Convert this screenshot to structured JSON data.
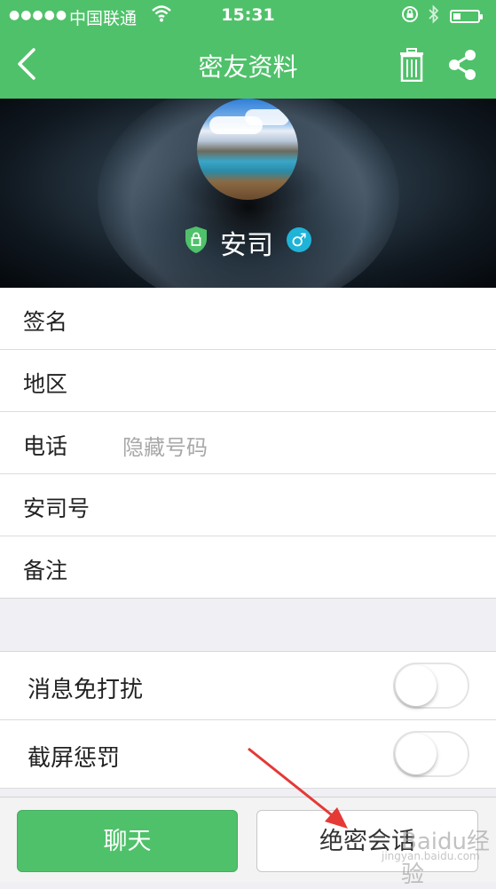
{
  "status_bar": {
    "signal": "●●●●●",
    "carrier": "中国联通",
    "time": "15:31"
  },
  "nav": {
    "title": "密友资料"
  },
  "profile": {
    "nickname": "安司",
    "gender_symbol": "♂"
  },
  "info_rows": [
    {
      "label": "签名",
      "value": ""
    },
    {
      "label": "地区",
      "value": ""
    },
    {
      "label": "电话",
      "value": "隐藏号码"
    },
    {
      "label": "安司号",
      "value": ""
    },
    {
      "label": "备注",
      "value": ""
    }
  ],
  "settings": [
    {
      "label": "消息免打扰",
      "on": false
    },
    {
      "label": "截屏惩罚",
      "on": false
    }
  ],
  "buttons": {
    "chat": "聊天",
    "secret_chat": "绝密会话"
  },
  "watermark": {
    "text": "Baidu经验",
    "url": "jingyan.baidu.com"
  },
  "colors": {
    "primary": "#4fc16a",
    "gender": "#1fb3d8",
    "annotation_arrow": "#e53935"
  },
  "icons": {
    "back": "chevron-left-icon",
    "trash": "trash-icon",
    "share": "share-icon",
    "shield": "shield-lock-icon"
  }
}
